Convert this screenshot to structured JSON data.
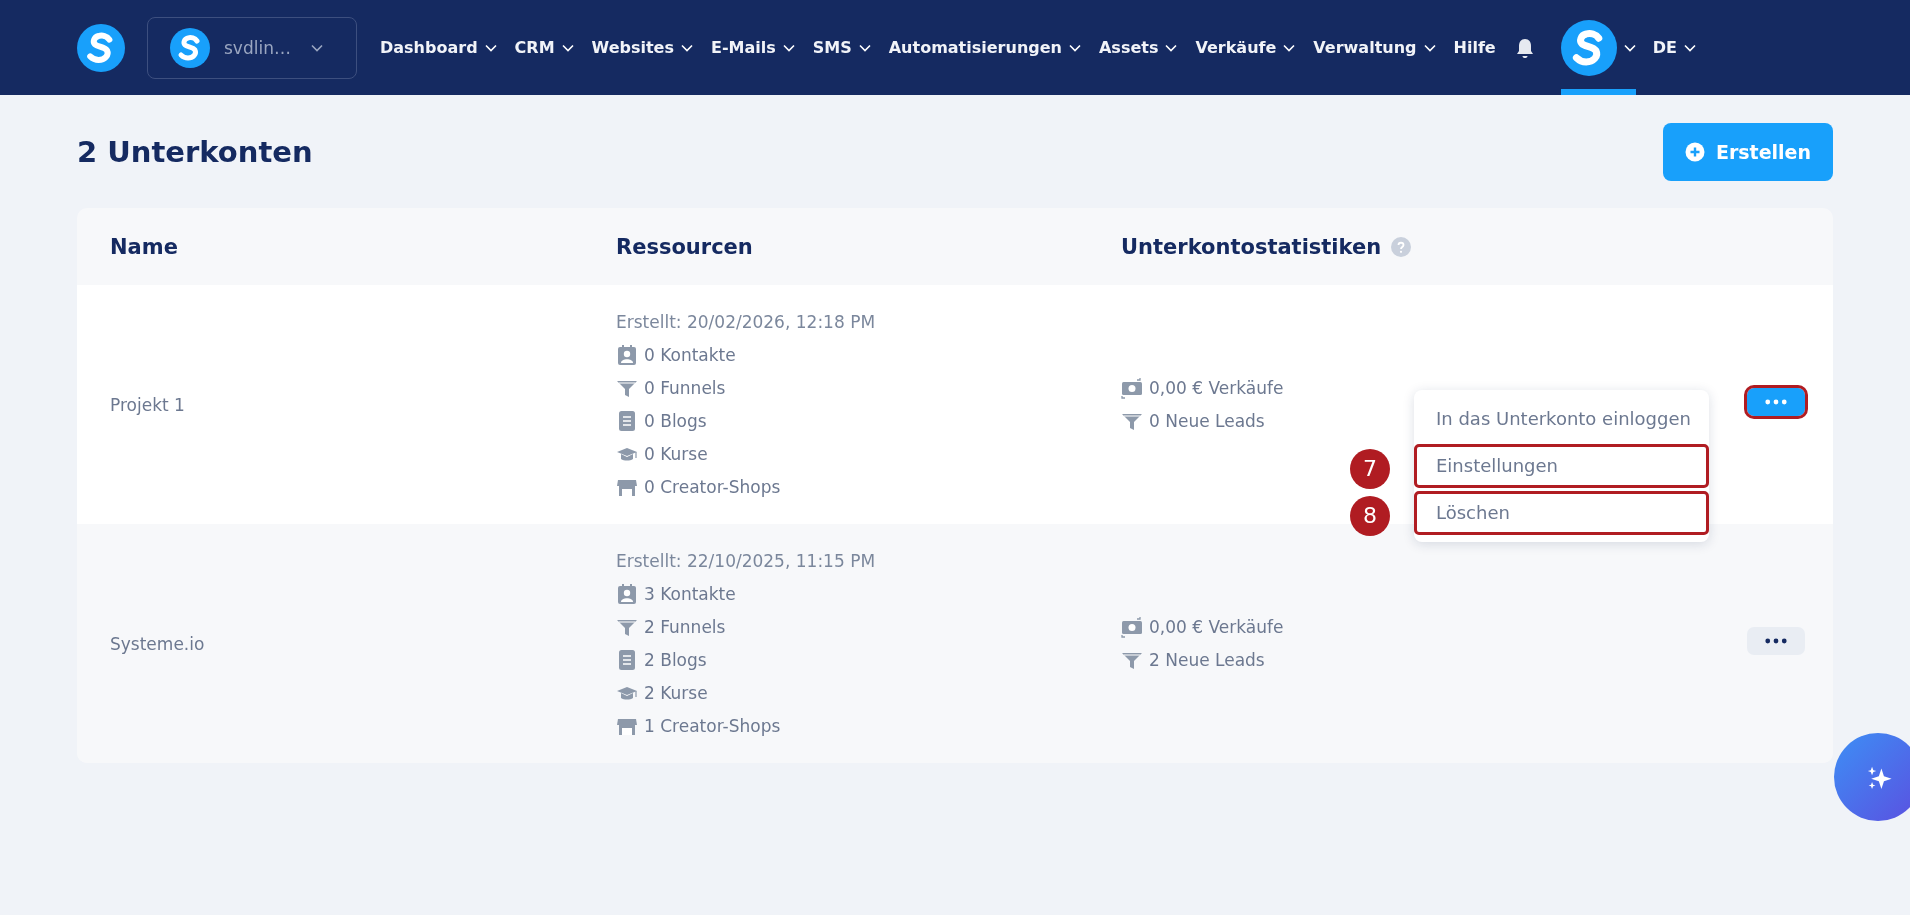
{
  "header": {
    "account": {
      "label": "svdlin…"
    },
    "nav": [
      {
        "label": "Dashboard",
        "dropdown": true
      },
      {
        "label": "CRM",
        "dropdown": true
      },
      {
        "label": "Websites",
        "dropdown": true
      },
      {
        "label": "E-Mails",
        "dropdown": true
      },
      {
        "label": "SMS",
        "dropdown": true
      },
      {
        "label": "Automatisierungen",
        "dropdown": true
      },
      {
        "label": "Assets",
        "dropdown": true
      },
      {
        "label": "Verkäufe",
        "dropdown": true
      },
      {
        "label": "Verwaltung",
        "dropdown": true
      },
      {
        "label": "Hilfe",
        "dropdown": false
      }
    ],
    "avatar": {
      "selected": true
    },
    "language": "DE"
  },
  "page": {
    "title": "2 Unterkonten",
    "create_button": "Erstellen"
  },
  "table": {
    "columns": [
      {
        "label": "Name",
        "help": false
      },
      {
        "label": "Ressourcen",
        "help": false
      },
      {
        "label": "Unterkontostatistiken",
        "help": true
      }
    ],
    "rows": [
      {
        "name": "Projekt 1",
        "created": "Erstellt: 20/02/2026, 12:18 PM",
        "resources": [
          {
            "kind": "contacts",
            "text": "0 Kontakte"
          },
          {
            "kind": "funnels",
            "text": "0 Funnels"
          },
          {
            "kind": "blogs",
            "text": "0 Blogs"
          },
          {
            "kind": "courses",
            "text": "0 Kurse"
          },
          {
            "kind": "shops",
            "text": "0 Creator-Shops"
          }
        ],
        "stats": [
          {
            "kind": "sales",
            "text": "0,00 € Verkäufe"
          },
          {
            "kind": "leads",
            "text": "0 Neue Leads"
          }
        ],
        "menu_open": true,
        "highlighted": true,
        "menu": [
          {
            "label": "In das Unterkonto einloggen",
            "highlighted": false
          },
          {
            "label": "Einstellungen",
            "highlighted": true,
            "step": "7"
          },
          {
            "label": "Löschen",
            "highlighted": true,
            "step": "8"
          }
        ]
      },
      {
        "name": "Systeme.io",
        "created": "Erstellt: 22/10/2025, 11:15 PM",
        "resources": [
          {
            "kind": "contacts",
            "text": "3 Kontakte"
          },
          {
            "kind": "funnels",
            "text": "2 Funnels"
          },
          {
            "kind": "blogs",
            "text": "2 Blogs"
          },
          {
            "kind": "courses",
            "text": "2 Kurse"
          },
          {
            "kind": "shops",
            "text": "1 Creator-Shops"
          }
        ],
        "stats": [
          {
            "kind": "sales",
            "text": "0,00 € Verkäufe"
          },
          {
            "kind": "leads",
            "text": "2 Neue Leads"
          }
        ],
        "menu_open": false,
        "highlighted": false
      }
    ]
  }
}
